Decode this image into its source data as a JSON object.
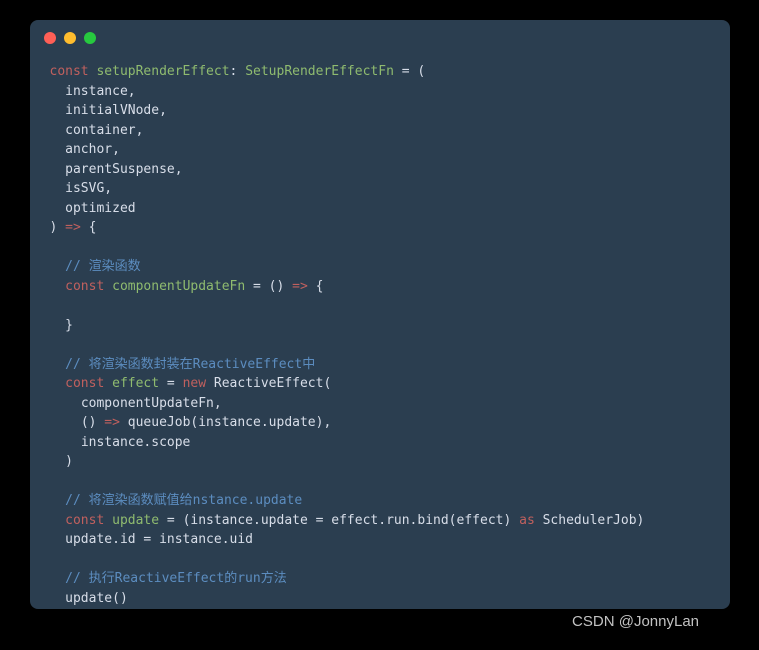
{
  "code": {
    "l1": {
      "kw": "const",
      "fn": "setupRenderEffect",
      "punct1": ": ",
      "type": "SetupRenderEffectFn",
      "punct2": " = ("
    },
    "params": [
      "instance",
      "initialVNode",
      "container",
      "anchor",
      "parentSuspense",
      "isSVG",
      "optimized"
    ],
    "closeParams": {
      "p1": ") ",
      "op": "=>",
      "p2": " {"
    },
    "c1": "// 渲染函数",
    "l2": {
      "kw": "const",
      "fn": "componentUpdateFn",
      "punct1": " = () ",
      "op": "=>",
      "punct2": " {"
    },
    "closeC1": "}",
    "c2": "// 将渲染函数封装在ReactiveEffect中",
    "l3": {
      "kw": "const",
      "fn": "effect",
      "punct1": " = ",
      "kw2": "new",
      "rest": " ReactiveEffect("
    },
    "l3a": "componentUpdateFn,",
    "l3b": {
      "p1": "() ",
      "op": "=>",
      "rest": " queueJob(instance.update),"
    },
    "l3c": "instance.scope",
    "closeL3": ")",
    "c3": "// 将渲染函数赋值给nstance.update",
    "l4": {
      "kw": "const",
      "fn": "update",
      "rest1": " = (instance.update = effect.run.bind(effect) ",
      "kw2": "as",
      "rest2": " SchedulerJob)"
    },
    "l5": "update.id = instance.uid",
    "c4": "// 执行ReactiveEffect的run方法",
    "l6": "update()",
    "closeAll": "}"
  },
  "watermark": "CSDN @JonnyLan"
}
